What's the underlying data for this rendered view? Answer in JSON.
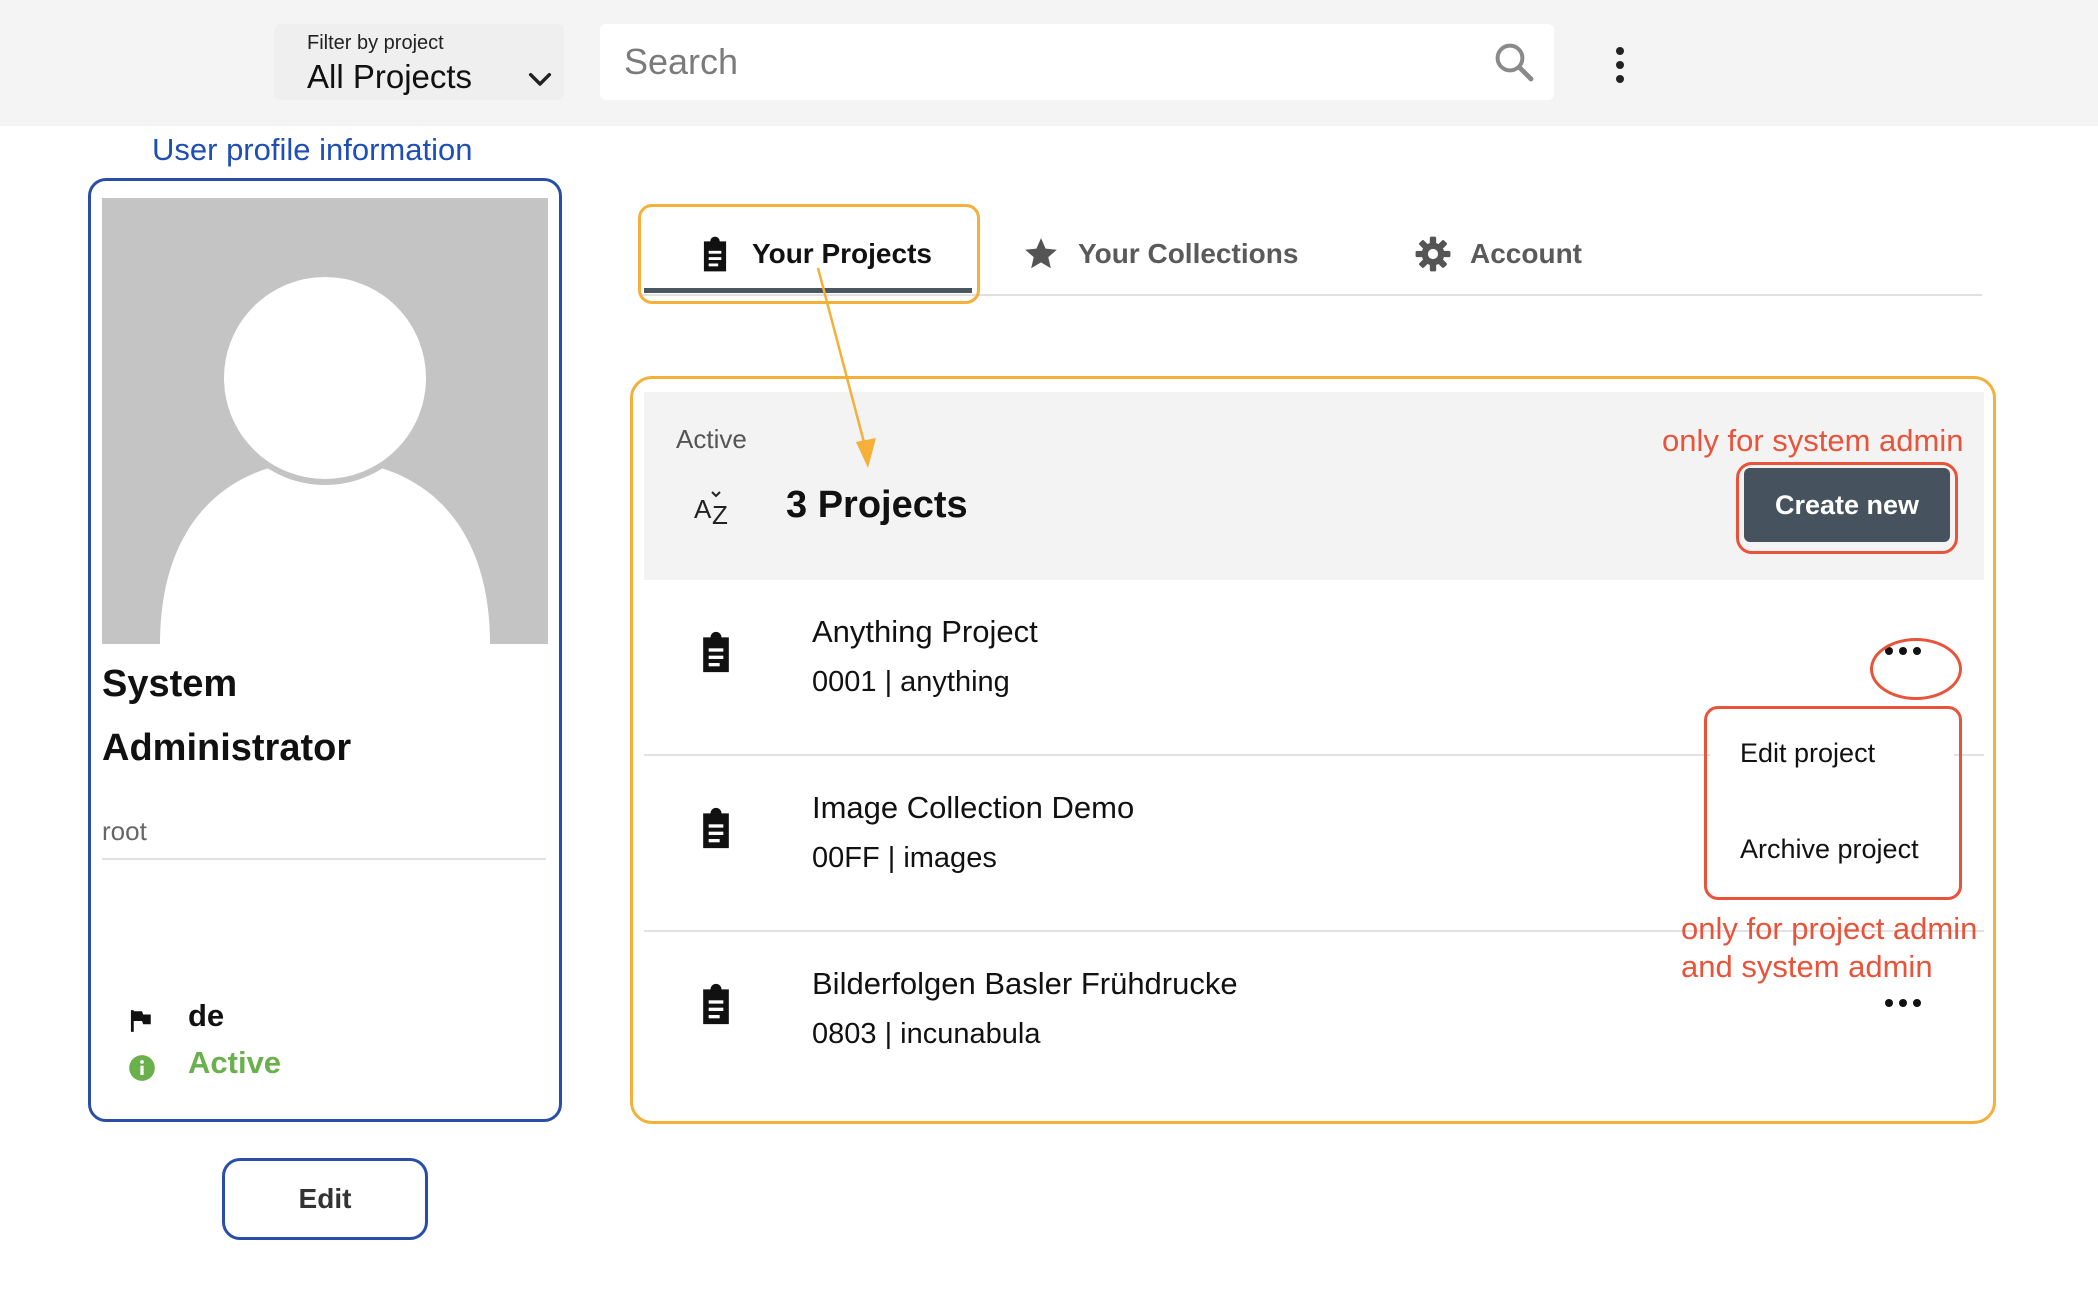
{
  "topbar": {
    "filter_label": "Filter by project",
    "filter_value": "All Projects",
    "search_placeholder": "Search"
  },
  "annotations": {
    "profile_label": "User profile information",
    "system_admin_note": "only for system admin",
    "project_admin_note_line1": "only for project admin",
    "project_admin_note_line2": "and system admin"
  },
  "profile": {
    "name_line1": "System",
    "name_line2": "Administrator",
    "username": "root",
    "language": "de",
    "status": "Active",
    "edit_label": "Edit"
  },
  "tabs": [
    {
      "label": "Your Projects",
      "icon": "clipboard-icon",
      "active": true
    },
    {
      "label": "Your Collections",
      "icon": "star-icon",
      "active": false
    },
    {
      "label": "Account",
      "icon": "gear-icon",
      "active": false
    }
  ],
  "list": {
    "status": "Active",
    "count_label": "3 Projects",
    "create_label": "Create new",
    "projects": [
      {
        "title": "Anything Project",
        "subtitle": "0001 | anything"
      },
      {
        "title": "Image Collection Demo",
        "subtitle": "00FF | images"
      },
      {
        "title": "Bilderfolgen Basler Frühdrucke",
        "subtitle": "0803 | incunabula"
      }
    ],
    "menu": {
      "edit": "Edit project",
      "archive": "Archive project"
    }
  },
  "colors": {
    "active_status": "#6ab04c",
    "primary_button": "#46535e",
    "annotation_blue": "#2a4ea8",
    "annotation_orange": "#f5b03a",
    "annotation_red": "#e8533a"
  }
}
